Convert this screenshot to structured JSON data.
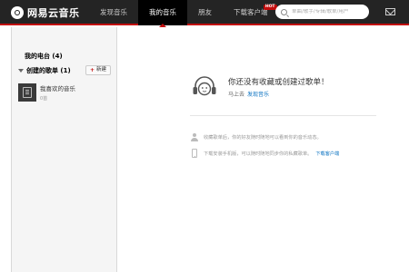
{
  "app": {
    "name": "网易云音乐"
  },
  "nav": {
    "items": [
      {
        "label": "发现音乐",
        "active": false
      },
      {
        "label": "我的音乐",
        "active": true
      },
      {
        "label": "朋友",
        "active": false
      },
      {
        "label": "下载客户端",
        "active": false,
        "badge": "HOT"
      }
    ]
  },
  "search": {
    "placeholder": "单曲/歌手/专辑/歌单/用户"
  },
  "icons": {
    "search": "search-icon",
    "mail": "mail-icon",
    "logo": "netease-logo-icon",
    "headphone": "headphone-icon",
    "user": "user-icon",
    "phone": "phone-icon"
  },
  "colors": {
    "accent": "#c20c0c",
    "link": "#0c73c2",
    "topbar": "#242424"
  },
  "sidebar": {
    "radio_title": "我的电台 (4)",
    "created_title": "创建的歌单 (1)",
    "new_button": "新建",
    "playlists": [
      {
        "name": "我喜欢的音乐",
        "count": "0首"
      }
    ]
  },
  "main": {
    "empty_title": "你还没有收藏或创建过歌单！",
    "hint_prefix": "马上去",
    "hint_link": "发现音乐",
    "tip1": "收藏歌单后，你的好友随时随地可以看到你的音乐动态。",
    "tip2": "下载安装手机版，可以随时随地同步你的私藏歌单。",
    "tip2_link": "下载客户端"
  }
}
